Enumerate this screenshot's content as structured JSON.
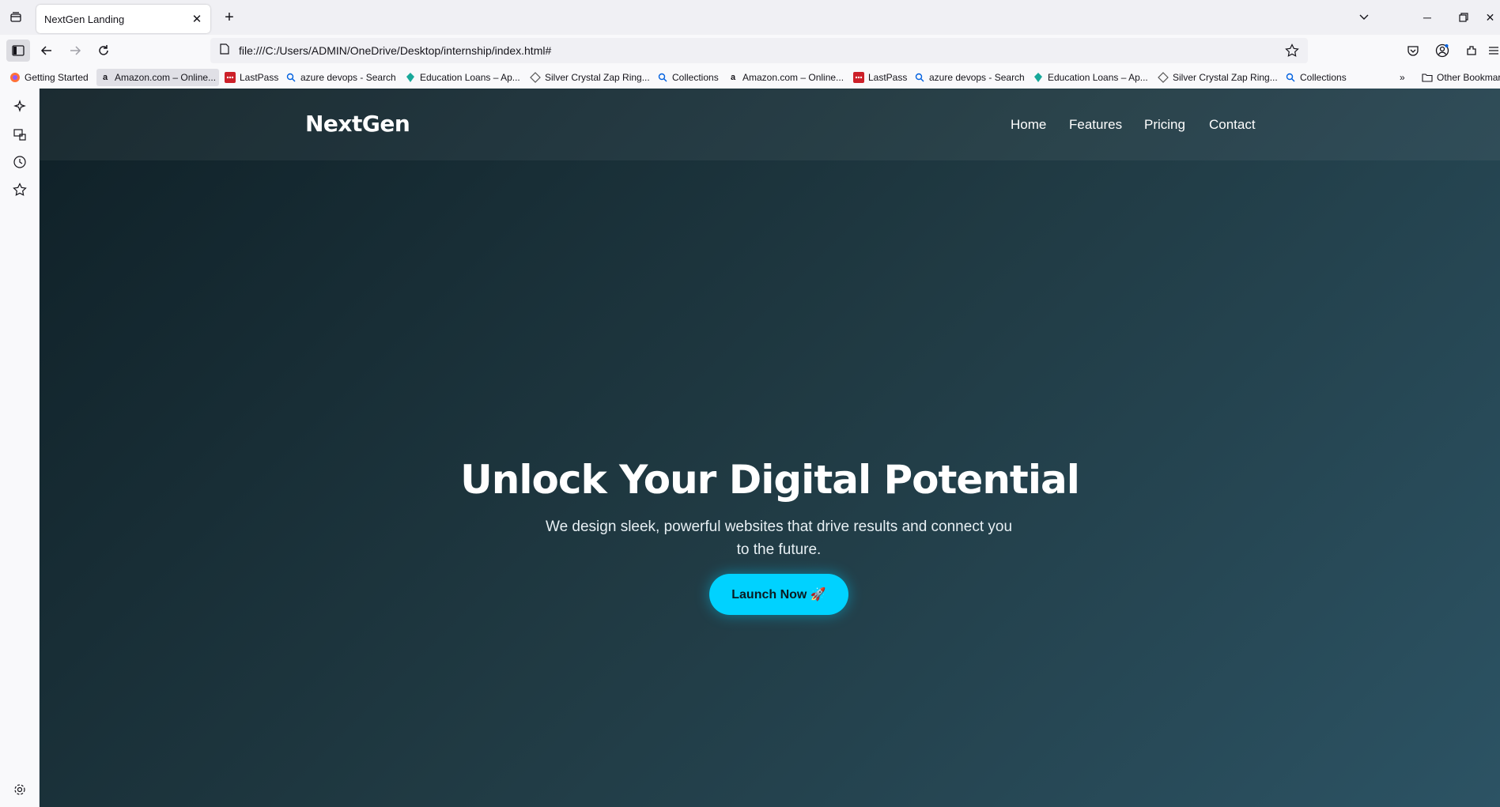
{
  "browser": {
    "tab": {
      "title": "NextGen Landing"
    },
    "url": "file:///C:/Users/ADMIN/OneDrive/Desktop/internship/index.html#",
    "bookmarks": [
      {
        "label": "Getting Started",
        "icon": "firefox-icon"
      },
      {
        "label": "Amazon.com – Online...",
        "icon": "amazon-icon"
      },
      {
        "label": "LastPass",
        "icon": "lastpass-icon"
      },
      {
        "label": "azure devops - Search",
        "icon": "search-icon"
      },
      {
        "label": "Education Loans – Ap...",
        "icon": "diamond-icon"
      },
      {
        "label": "Silver Crystal Zap Ring...",
        "icon": "ring-icon"
      },
      {
        "label": "Collections",
        "icon": "search-icon"
      },
      {
        "label": "Amazon.com – Online...",
        "icon": "amazon-icon"
      },
      {
        "label": "LastPass",
        "icon": "lastpass-icon"
      },
      {
        "label": "azure devops - Search",
        "icon": "search-icon"
      },
      {
        "label": "Education Loans – Ap...",
        "icon": "diamond-icon"
      },
      {
        "label": "Silver Crystal Zap Ring...",
        "icon": "ring-icon"
      },
      {
        "label": "Collections",
        "icon": "search-icon"
      }
    ],
    "other_bookmarks": "Other Bookmarks"
  },
  "site": {
    "logo": "NextGen",
    "nav": [
      "Home",
      "Features",
      "Pricing",
      "Contact"
    ],
    "hero": {
      "title": "Unlock Your Digital Potential",
      "subtitle": "We design sleek, powerful websites that drive results and connect you to the future.",
      "cta": "Launch Now 🚀"
    }
  },
  "colors": {
    "gradient_start": "#0f2027",
    "gradient_mid": "#203a43",
    "gradient_end": "#2c5364",
    "accent": "#00d2ff"
  }
}
